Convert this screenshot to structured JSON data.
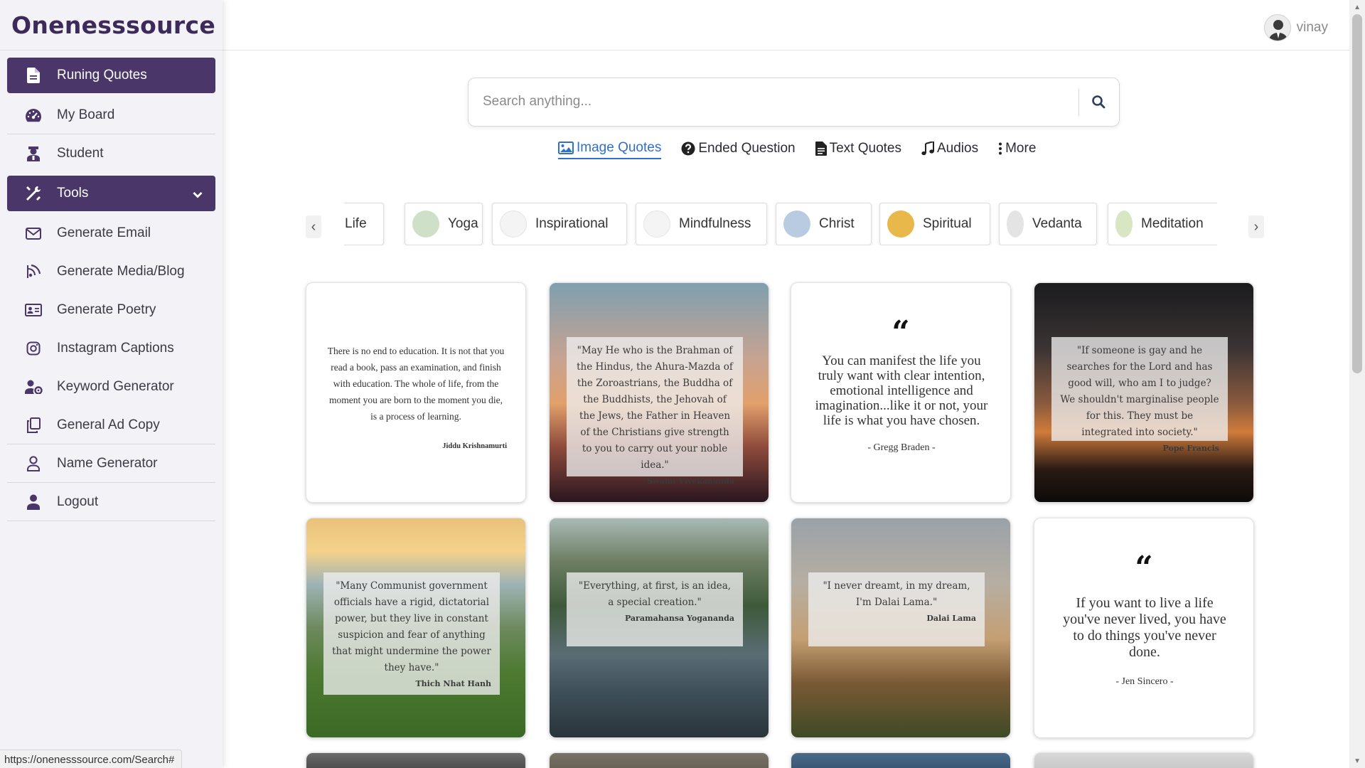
{
  "brand": {
    "name": "Onenesssource"
  },
  "sidebar": {
    "items": [
      {
        "label": "Runing Quotes",
        "icon": "file-icon",
        "active": true
      },
      {
        "label": "My Board",
        "icon": "dashboard-icon"
      },
      {
        "label": "Student",
        "icon": "student-icon"
      },
      {
        "label": "Tools",
        "icon": "tools-icon",
        "active": true,
        "expandable": true
      },
      {
        "label": "Generate Email",
        "icon": "envelope-icon"
      },
      {
        "label": "Generate Media/Blog",
        "icon": "blog-icon"
      },
      {
        "label": "Generate Poetry",
        "icon": "id-card-icon"
      },
      {
        "label": "Instagram Captions",
        "icon": "instagram-icon"
      },
      {
        "label": "Keyword Generator",
        "icon": "user-cog-icon"
      },
      {
        "label": "General Ad Copy",
        "icon": "copy-icon"
      },
      {
        "label": "Name Generator",
        "icon": "user-outline-icon"
      },
      {
        "label": "Logout",
        "icon": "user-solid-icon"
      }
    ]
  },
  "status_url": "https://onenesssource.com/Search#",
  "user": {
    "name": "vinay"
  },
  "search": {
    "placeholder": "Search anything..."
  },
  "tabs": [
    {
      "label": "Image Quotes",
      "icon": "image-icon",
      "active": true
    },
    {
      "label": "Ended Question",
      "icon": "question-circle-icon"
    },
    {
      "label": "Text Quotes",
      "icon": "file-text-icon"
    },
    {
      "label": "Audios",
      "icon": "music-icon"
    },
    {
      "label": "More",
      "icon": "vertical-dots-icon"
    }
  ],
  "categories": [
    {
      "label": "Life",
      "color": "#f2d89a"
    },
    {
      "label": "Yoga",
      "color": "#cfe0c8"
    },
    {
      "label": "Inspirational",
      "color": "#f4f4f4"
    },
    {
      "label": "Mindfulness",
      "color": "#f4f4f4"
    },
    {
      "label": "Christ",
      "color": "#b9cbe0"
    },
    {
      "label": "Spiritual",
      "color": "#e8b84a"
    },
    {
      "label": "Vedanta",
      "color": "#e4e4e4"
    },
    {
      "label": "Meditation",
      "color": "#d8e6c4"
    }
  ],
  "cards": [
    {
      "quote": "There is no end to education. It is not that you read a book, pass an examination, and finish with education. The whole of life, from the moment you are born to the moment you die, is a process of learning.",
      "author": "Jiddu Krishnamurti"
    },
    {
      "quote": "\"May He who is the Brahman of the Hindus, the Ahura-Mazda of the Zoroastrians, the Buddha of the Buddhists, the Jehovah of the Jews, the Father in Heaven of the Christians give strength to you to carry out your noble idea.\"",
      "author": "Swami Vivekananda"
    },
    {
      "quote": "You can manifest the life you truly want with clear intention, emotional intelligence and imagination...like it or not, your life is what you have chosen.",
      "author": "- Gregg Braden -"
    },
    {
      "quote": "\"If someone is gay and he searches for the Lord and has good will, who am I to judge? We shouldn't marginalise people for this. They must be integrated into society.\"",
      "author": "Pope Francis"
    },
    {
      "quote": "\"Many Communist government officials have a rigid, dictatorial power, but they live in constant suspicion and fear of anything that might undermine the power they have.\"",
      "author": "Thich Nhat Hanh"
    },
    {
      "quote": "\"Everything, at first, is an idea, a special creation.\"",
      "author": "Paramahansa Yogananda"
    },
    {
      "quote": "\"I never dreamt, in my dream, I'm Dalai Lama.\"",
      "author": "Dalai Lama"
    },
    {
      "quote": "If you want to live a life you've never lived, you have to do things you've never done.",
      "author": "- Jen Sincero -"
    }
  ],
  "quote_mark": "“"
}
